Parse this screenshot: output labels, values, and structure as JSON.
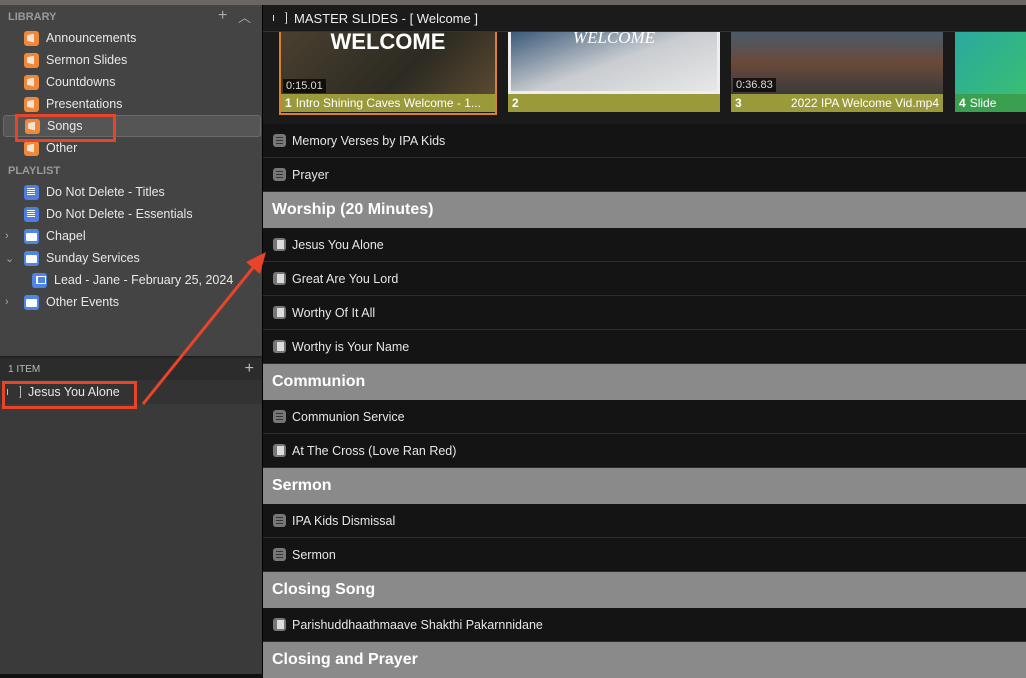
{
  "library": {
    "title": "LIBRARY",
    "items": [
      "Announcements",
      "Sermon Slides",
      "Countdowns",
      "Presentations",
      "Songs",
      "Other"
    ],
    "selected": "Songs"
  },
  "playlist": {
    "title": "PLAYLIST",
    "items": [
      {
        "label": "Do Not Delete - Titles",
        "icon": "playlist"
      },
      {
        "label": "Do Not Delete - Essentials",
        "icon": "playlist"
      },
      {
        "label": "Chapel",
        "icon": "folder",
        "chevron": ">"
      },
      {
        "label": "Sunday Services",
        "icon": "folder",
        "chevron": "v"
      },
      {
        "label": "Lead - Jane - February 25, 2024",
        "icon": "flag"
      },
      {
        "label": "Other Events",
        "icon": "folder",
        "chevron": ">"
      }
    ]
  },
  "bottom": {
    "count": "1 ITEM",
    "add": "+",
    "item": "Jesus You Alone"
  },
  "main": {
    "title": "MASTER SLIDES - [ Welcome ]",
    "thumbs": [
      {
        "num": "1",
        "label": "Intro Shining Caves Welcome - 1...",
        "duration": "0:15.01",
        "img_text": "WELCOME"
      },
      {
        "num": "2",
        "label": "",
        "img_text": "WELCOME"
      },
      {
        "num": "3",
        "label": "2022 IPA Welcome Vid.mp4",
        "duration": "0:36.83"
      },
      {
        "num": "4",
        "label": "Slide"
      }
    ],
    "rows": [
      {
        "type": "doc",
        "label": "Memory Verses by IPA Kids"
      },
      {
        "type": "doc",
        "label": "Prayer"
      },
      {
        "type": "header",
        "label": "Worship (20 Minutes)"
      },
      {
        "type": "song",
        "label": "Jesus You Alone"
      },
      {
        "type": "song",
        "label": "Great Are You Lord"
      },
      {
        "type": "song",
        "label": "Worthy Of It All"
      },
      {
        "type": "song",
        "label": "Worthy is Your Name"
      },
      {
        "type": "header",
        "label": "Communion"
      },
      {
        "type": "doc",
        "label": "Communion Service"
      },
      {
        "type": "song",
        "label": "At The Cross (Love Ran Red)"
      },
      {
        "type": "header",
        "label": "Sermon"
      },
      {
        "type": "doc",
        "label": "IPA Kids Dismissal"
      },
      {
        "type": "doc",
        "label": "Sermon"
      },
      {
        "type": "header",
        "label": "Closing Song"
      },
      {
        "type": "song",
        "label": "Parishuddhaathmaave Shakthi Pakarnnidane"
      },
      {
        "type": "header",
        "label": "Closing and Prayer"
      }
    ]
  },
  "colors": {
    "annotation": "#e8442a",
    "library_icon": "#f0883a",
    "caption": "#9a9a3a"
  }
}
